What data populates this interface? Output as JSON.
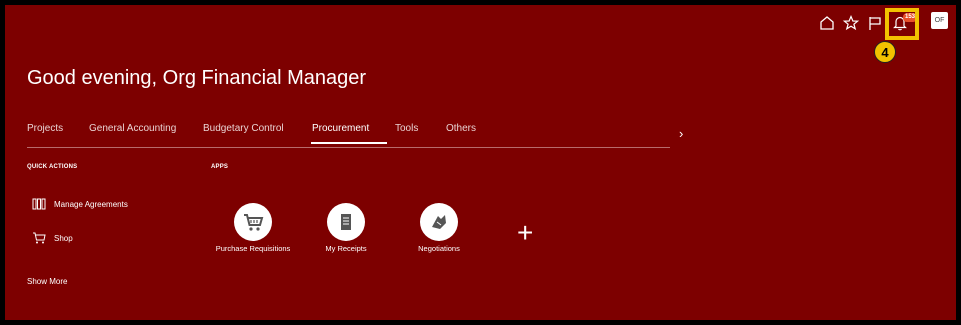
{
  "header": {
    "greeting": "Good evening, Org Financial Manager",
    "notification_count": "153",
    "avatar_initials": "OF",
    "step_number": "4"
  },
  "tabs": [
    {
      "label": "Projects"
    },
    {
      "label": "General Accounting"
    },
    {
      "label": "Budgetary Control"
    },
    {
      "label": "Procurement"
    },
    {
      "label": "Tools"
    },
    {
      "label": "Others"
    }
  ],
  "quick_actions": {
    "title": "QUICK ACTIONS",
    "items": [
      {
        "label": "Manage Agreements",
        "icon": "agreements-icon"
      },
      {
        "label": "Shop",
        "icon": "cart-icon"
      }
    ],
    "show_more": "Show More"
  },
  "apps": {
    "title": "APPS",
    "items": [
      {
        "label": "Purchase Requisitions",
        "icon": "cart-icon"
      },
      {
        "label": "My Receipts",
        "icon": "receipt-icon"
      },
      {
        "label": "Negotiations",
        "icon": "negotiation-icon"
      }
    ]
  },
  "colors": {
    "background": "#7d0000",
    "highlight": "#f2c200",
    "badge": "#e8502a"
  }
}
